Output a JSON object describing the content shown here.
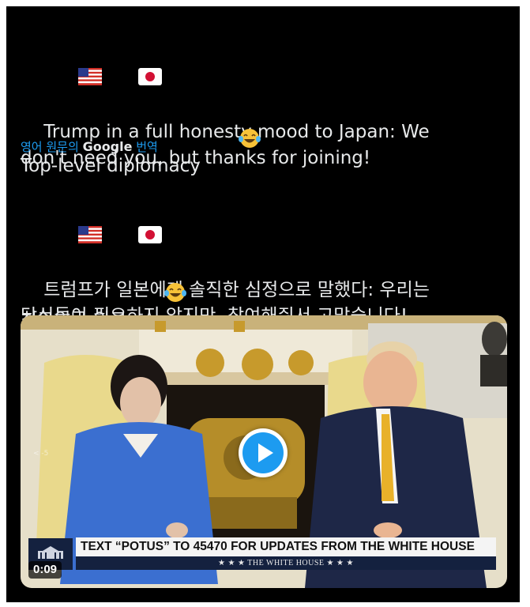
{
  "post": {
    "line1": "Trump in a full honesty mood to Japan: We\ndon't need you, but thanks for joining!",
    "line2": "Top-level diplomacy",
    "translate_prefix": "영어 원문의",
    "translate_brand": "Google",
    "translate_suffix": "번역",
    "ko_line1": "트럼프가 일본에게 솔직한 심정으로 말했다: 우리는\n당신들이 필요하지 않지만, 참여해줘서 고맙습니다!",
    "ko_line2": "최고위급 외교"
  },
  "video": {
    "banner_text": "TEXT “POTUS” TO 45470 FOR UPDATES FROM THE WHITE HOUSE",
    "banner_sub": "★ ★ ★   THE WHITE HOUSE   ★ ★ ★",
    "duration": "0:09",
    "watermark": "< -5"
  },
  "colors": {
    "background": "#000000",
    "text": "#e7e9ea",
    "link": "#1d9bf0",
    "play_button": "#1d9bf0"
  },
  "icons": [
    "us-flag-icon",
    "japan-flag-icon",
    "laughing-emoji-icon",
    "play-icon"
  ]
}
